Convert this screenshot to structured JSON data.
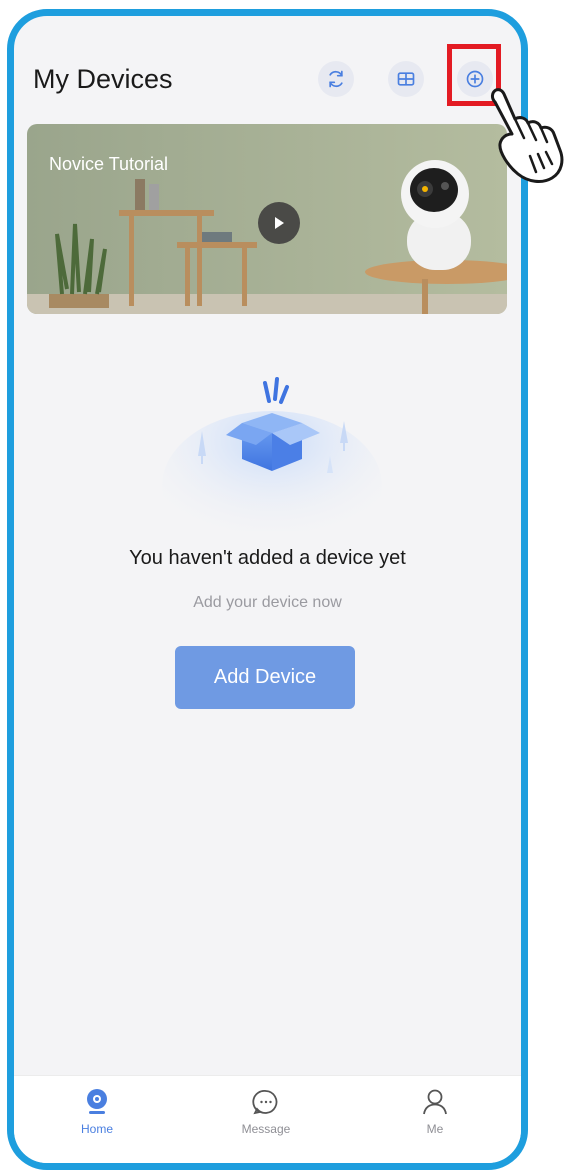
{
  "header": {
    "title": "My Devices",
    "icons": [
      "refresh-icon",
      "grid-icon",
      "plus-circle-icon"
    ]
  },
  "banner": {
    "title": "Novice Tutorial",
    "icon": "play-icon"
  },
  "empty_state": {
    "title": "You haven't added a device yet",
    "subtitle": "Add your device now",
    "button_label": "Add Device"
  },
  "tabbar": {
    "items": [
      {
        "label": "Home",
        "icon": "home-camera-icon",
        "active": true
      },
      {
        "label": "Message",
        "icon": "message-icon",
        "active": false
      },
      {
        "label": "Me",
        "icon": "profile-icon",
        "active": false
      }
    ]
  },
  "colors": {
    "frame": "#1e9ede",
    "accent": "#4a7fe0",
    "button": "#6f9ae3",
    "highlight": "#e31b23"
  }
}
